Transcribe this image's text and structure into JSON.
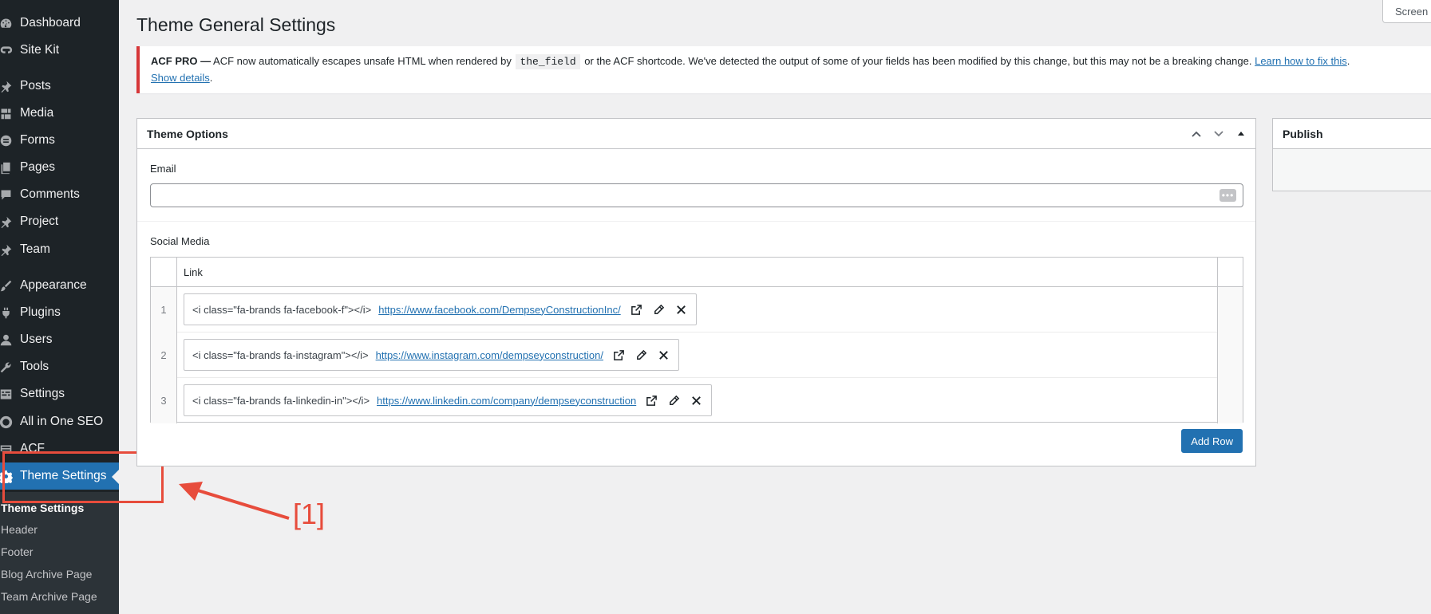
{
  "sidebar": {
    "items": [
      {
        "label": "Dashboard",
        "icon": "dashboard-icon"
      },
      {
        "label": "Site Kit",
        "icon": "site-kit-icon"
      },
      {
        "label": "Posts",
        "icon": "pin-icon"
      },
      {
        "label": "Media",
        "icon": "media-icon"
      },
      {
        "label": "Forms",
        "icon": "forms-icon"
      },
      {
        "label": "Pages",
        "icon": "pages-icon"
      },
      {
        "label": "Comments",
        "icon": "comments-icon"
      },
      {
        "label": "Project",
        "icon": "pin-icon"
      },
      {
        "label": "Team",
        "icon": "pin-icon"
      },
      {
        "label": "Appearance",
        "icon": "brush-icon"
      },
      {
        "label": "Plugins",
        "icon": "plugin-icon"
      },
      {
        "label": "Users",
        "icon": "users-icon"
      },
      {
        "label": "Tools",
        "icon": "wrench-icon"
      },
      {
        "label": "Settings",
        "icon": "settings-icon"
      },
      {
        "label": "All in One SEO",
        "icon": "seo-icon"
      },
      {
        "label": "ACF",
        "icon": "acf-icon"
      },
      {
        "label": "Theme Settings",
        "icon": "gear-icon"
      }
    ],
    "submenu": [
      "Theme Settings",
      "Header",
      "Footer",
      "Blog Archive Page",
      "Team Archive Page"
    ]
  },
  "annotation": {
    "label": "[1]",
    "color": "#e74c3c"
  },
  "header": {
    "title": "Theme General Settings",
    "screen_options": "Screen"
  },
  "notice": {
    "strong": "ACF PRO —",
    "text1": " ACF now automatically escapes unsafe HTML when rendered by ",
    "code": "the_field",
    "text2": " or the ACF shortcode. We've detected the output of some of your fields has been modified by this change, but this may not be a breaking change. ",
    "link1": "Learn how to fix this",
    "period1": ".",
    "link2": "Show details",
    "period2": "."
  },
  "theme_options": {
    "title": "Theme Options",
    "email_label": "Email",
    "email_value": "",
    "social_label": "Social Media",
    "link_col": "Link",
    "rows": [
      {
        "index": "1",
        "text": "<i class=\"fa-brands fa-facebook-f\"></i>",
        "url": "https://www.facebook.com/DempseyConstructionInc/"
      },
      {
        "index": "2",
        "text": "<i class=\"fa-brands fa-instagram\"></i>",
        "url": "https://www.instagram.com/dempseyconstruction/"
      },
      {
        "index": "3",
        "text": "<i class=\"fa-brands fa-linkedin-in\"></i>",
        "url": "https://www.linkedin.com/company/dempseyconstruction"
      }
    ],
    "add_row": "Add Row"
  },
  "publish": {
    "title": "Publish"
  },
  "colors": {
    "sidebar_bg": "#1d2327",
    "accent": "#2271b1",
    "error": "#d63638"
  }
}
